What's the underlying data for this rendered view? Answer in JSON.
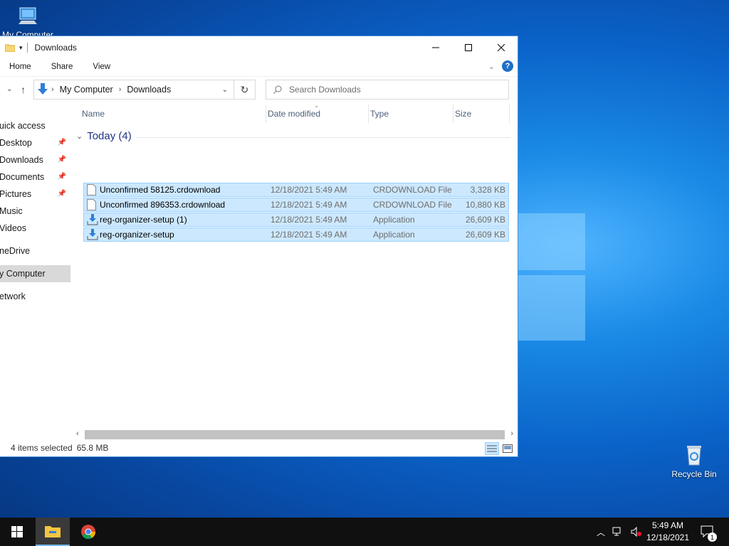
{
  "desktop": {
    "icons": [
      {
        "label": "My Computer",
        "icon": "computer-icon"
      },
      {
        "label": "Recycle Bin",
        "icon": "recycle-bin-icon"
      }
    ]
  },
  "window": {
    "title": "Downloads",
    "ribbon_tabs": [
      "Home",
      "Share",
      "View"
    ],
    "breadcrumb": [
      "My Computer",
      "Downloads"
    ],
    "search_placeholder": "Search Downloads",
    "columns": [
      "Name",
      "Date modified",
      "Type",
      "Size"
    ],
    "group": {
      "label": "Today (4)",
      "expanded": true
    },
    "files": [
      {
        "name": "Unconfirmed 58125.crdownload",
        "date": "12/18/2021 5:49 AM",
        "type": "CRDOWNLOAD File",
        "size": "3,328 KB",
        "icon": "document-file-icon",
        "selected": true
      },
      {
        "name": "Unconfirmed 896353.crdownload",
        "date": "12/18/2021 5:49 AM",
        "type": "CRDOWNLOAD File",
        "size": "10,880 KB",
        "icon": "document-file-icon",
        "selected": true
      },
      {
        "name": "reg-organizer-setup (1)",
        "date": "12/18/2021 5:49 AM",
        "type": "Application",
        "size": "26,609 KB",
        "icon": "installer-icon",
        "selected": true
      },
      {
        "name": "reg-organizer-setup",
        "date": "12/18/2021 5:49 AM",
        "type": "Application",
        "size": "26,609 KB",
        "icon": "installer-icon",
        "selected": true
      }
    ],
    "sidebar": [
      {
        "label": "uick access",
        "pinned": false,
        "selected": false
      },
      {
        "label": "Desktop",
        "pinned": true,
        "selected": false
      },
      {
        "label": "Downloads",
        "pinned": true,
        "selected": false
      },
      {
        "label": "Documents",
        "pinned": true,
        "selected": false
      },
      {
        "label": "Pictures",
        "pinned": true,
        "selected": false
      },
      {
        "label": "Music",
        "pinned": false,
        "selected": false
      },
      {
        "label": "Videos",
        "pinned": false,
        "selected": false
      },
      {
        "label": "neDrive",
        "pinned": false,
        "selected": false
      },
      {
        "label": "y Computer",
        "pinned": false,
        "selected": true
      },
      {
        "label": "etwork",
        "pinned": false,
        "selected": false
      }
    ],
    "status": {
      "selection": "4 items selected",
      "size": "65.8 MB"
    }
  },
  "taskbar": {
    "items": [
      "start-icon",
      "file-explorer-icon",
      "chrome-icon"
    ],
    "clock": {
      "time": "5:49 AM",
      "date": "12/18/2021"
    },
    "notification_count": "1"
  },
  "colors": {
    "selection_bg": "#cce8ff",
    "selection_border": "#99d1ff",
    "accent": "#1f6fc7",
    "taskbar": "#101010"
  }
}
